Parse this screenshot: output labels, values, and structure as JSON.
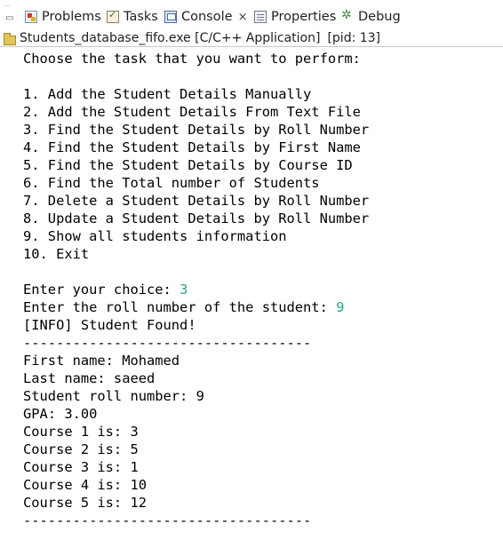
{
  "tabs": [
    {
      "label": "Problems",
      "icon": "problems-icon",
      "active": false
    },
    {
      "label": "Tasks",
      "icon": "tasks-icon",
      "active": false
    },
    {
      "label": "Console",
      "icon": "console-icon",
      "active": true,
      "close": "×"
    },
    {
      "label": "Properties",
      "icon": "properties-icon",
      "active": false
    },
    {
      "label": "Debug",
      "icon": "debug-icon",
      "active": false
    }
  ],
  "launch": {
    "name": "Students_database_fifo.exe [C/C++ Application]",
    "pid": "[pid: 13]"
  },
  "console": {
    "prompt": "Choose the task that you want to perform:",
    "menu": [
      "1. Add the Student Details Manually",
      "2. Add the Student Details From Text File",
      "3. Find the Student Details by Roll Number",
      "4. Find the Student Details by First Name",
      "5. Find the Student Details by Course ID",
      "6. Find the Total number of Students",
      "7. Delete a Student Details by Roll Number",
      "8. Update a Student Details by Roll Number",
      "9. Show all students information",
      "10. Exit"
    ],
    "choice_label": "Enter your choice: ",
    "choice_value": "3",
    "roll_label": "Enter the roll number of the student: ",
    "roll_value": "9",
    "info": "[INFO] Student Found!",
    "separator": "-----------------------------------",
    "details": [
      "First name: Mohamed",
      "Last name: saeed",
      "Student roll number: 9",
      "GPA: 3.00",
      "Course 1 is: 3",
      "Course 2 is: 5",
      "Course 3 is: 1",
      "Course 4 is: 10",
      "Course 5 is: 12"
    ]
  },
  "colors": {
    "user_input": "#2aa58a",
    "output_text": "#000000"
  }
}
